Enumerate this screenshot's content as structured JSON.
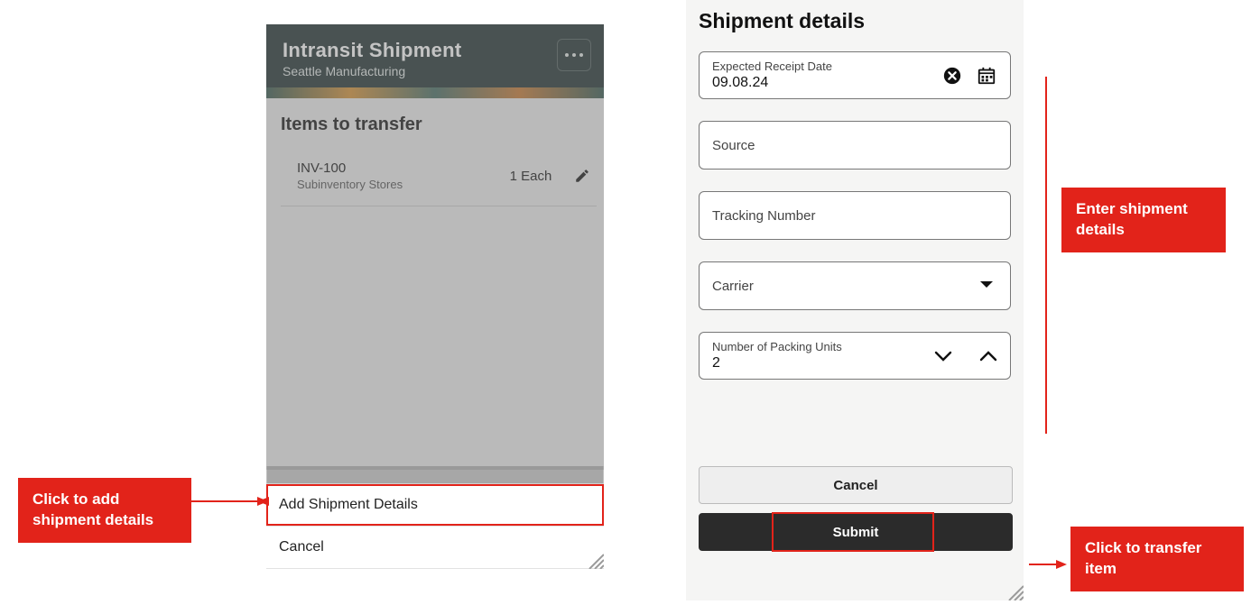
{
  "left_panel": {
    "title": "Intransit Shipment",
    "subtitle": "Seattle Manufacturing",
    "items_heading": "Items to transfer",
    "item": {
      "code": "INV-100",
      "sub": "Subinventory Stores",
      "qty": "1 Each"
    },
    "add_shipment": "Add Shipment Details",
    "cancel": "Cancel"
  },
  "right_panel": {
    "title": "Shipment details",
    "date_label": "Expected Receipt Date",
    "date_value": "09.08.24",
    "source_label": "Source",
    "tracking_label": "Tracking Number",
    "carrier_label": "Carrier",
    "packing_label": "Number of Packing Units",
    "packing_value": "2",
    "cancel": "Cancel",
    "submit": "Submit"
  },
  "callouts": {
    "add": "Click to add\nshipment details",
    "enter": "Enter shipment\ndetails",
    "transfer": "Click to transfer\nitem"
  }
}
